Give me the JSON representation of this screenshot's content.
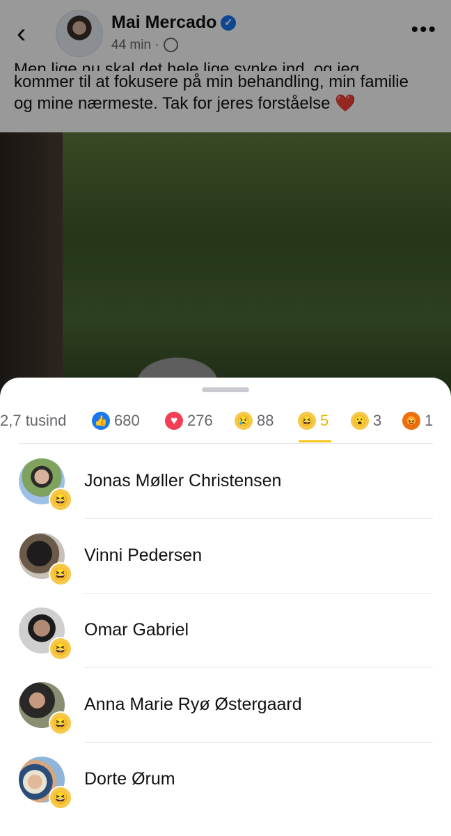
{
  "post": {
    "back_glyph": "‹",
    "author": "Mai Mercado",
    "verified_glyph": "✓",
    "time": "44 min",
    "dot": "·",
    "more_glyph": "•••",
    "text_line1": "Men lige nu skal det hele lige synke ind, og jeg",
    "text_line2": "kommer til at fokusere på min behandling, min familie",
    "text_line3": "og mine nærmeste. Tak for jeres forståelse",
    "heart_emoji": "❤️",
    "icons": {
      "back": "chevron-left-icon",
      "verified": "verified-badge-icon",
      "globe": "globe-icon",
      "more": "more-icon"
    }
  },
  "reactions": {
    "tabs": [
      {
        "id": "all",
        "label": "2,7 tusind",
        "icon": ""
      },
      {
        "id": "like",
        "label": "680",
        "icon": "👍",
        "color": "#1877f2"
      },
      {
        "id": "love",
        "label": "276",
        "icon": "♥",
        "color": "#f33e58"
      },
      {
        "id": "sad",
        "label": "88",
        "icon": "😢",
        "color": "#f7c948"
      },
      {
        "id": "haha",
        "label": "5",
        "icon": "😆",
        "color": "#f7c948"
      },
      {
        "id": "wow",
        "label": "3",
        "icon": "😮",
        "color": "#f7c948"
      },
      {
        "id": "angry",
        "label": "1",
        "icon": "😡",
        "color": "#e9710f"
      }
    ],
    "active_tab": "haha",
    "active_color": "#f5c518",
    "people": [
      {
        "name": "Jonas Møller Christensen",
        "reaction": "😆"
      },
      {
        "name": "Vinni Pedersen",
        "reaction": "😆"
      },
      {
        "name": "Omar Gabriel",
        "reaction": "😆"
      },
      {
        "name": "Anna Marie Ryø Østergaard",
        "reaction": "😆"
      },
      {
        "name": "Dorte Ørum",
        "reaction": "😆"
      }
    ]
  }
}
